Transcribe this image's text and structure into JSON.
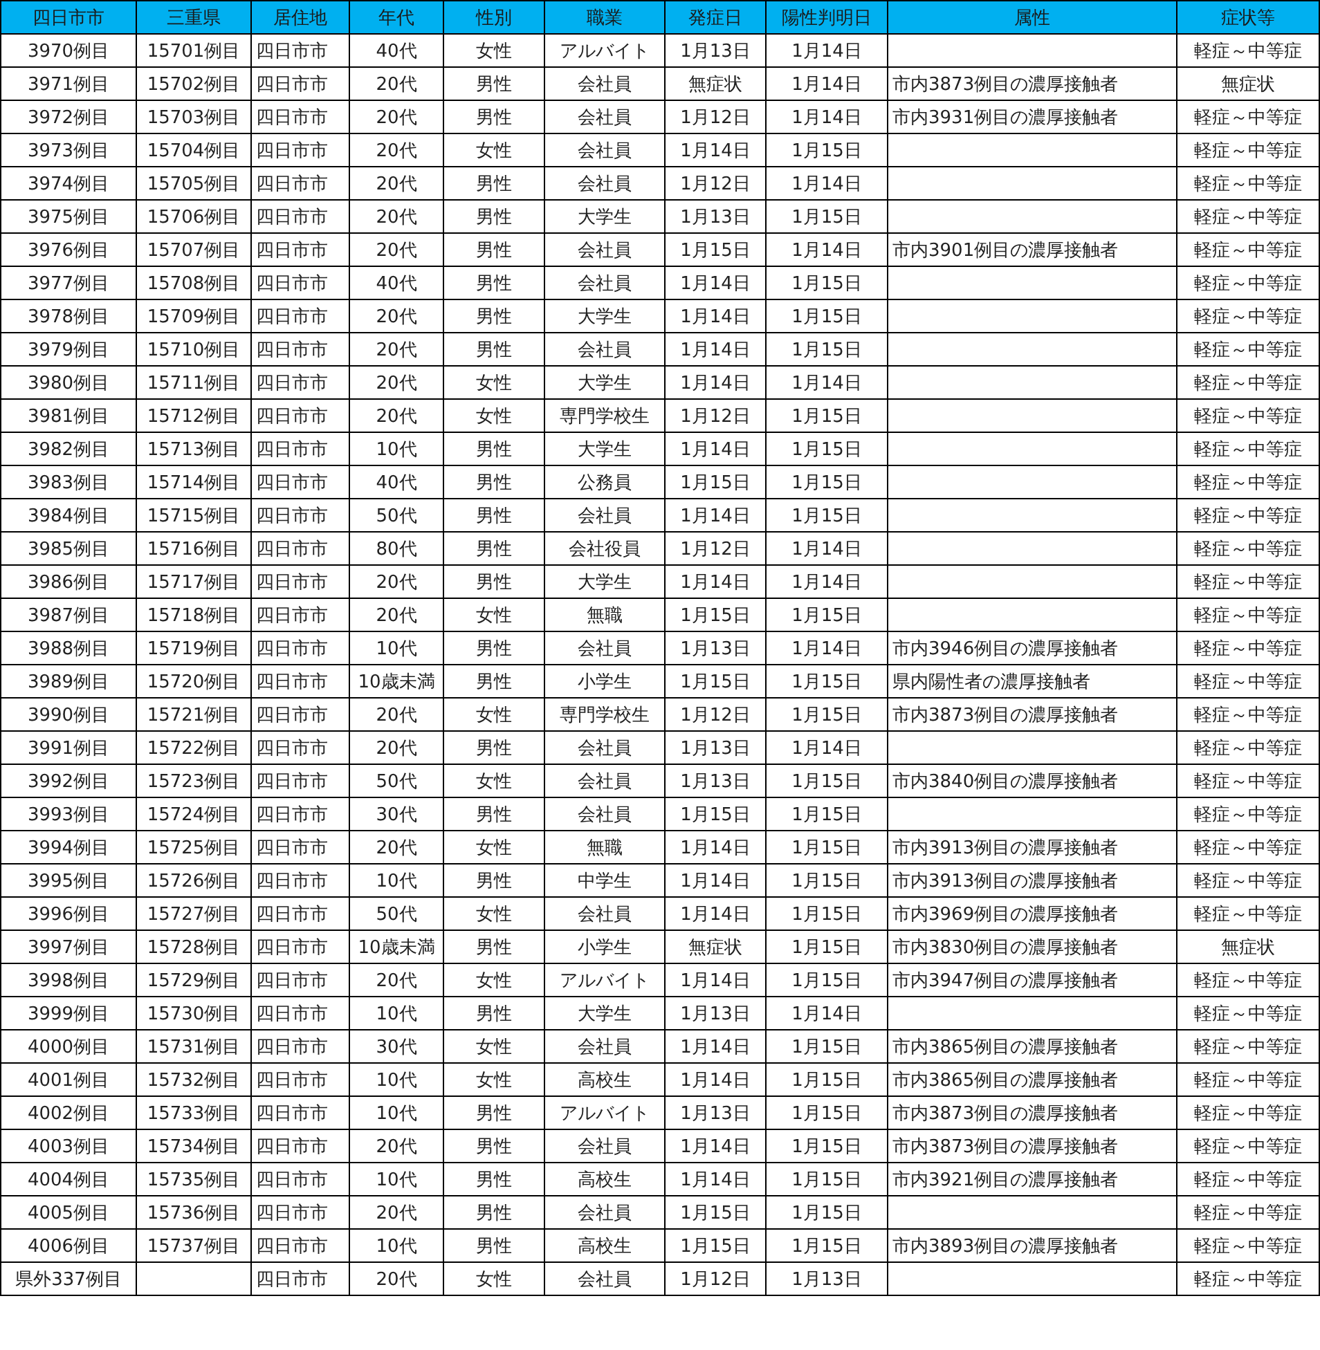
{
  "table": {
    "columns": [
      "四日市市",
      "三重県",
      "居住地",
      "年代",
      "性別",
      "職業",
      "発症日",
      "陽性判明日",
      "属性",
      "症状等"
    ],
    "rows": [
      {
        "city_no": "3970例目",
        "pref_no": "15701例目",
        "residence": "四日市市",
        "age": "40代",
        "sex": "女性",
        "occupation": "アルバイト",
        "onset": "1月13日",
        "confirmed": "1月14日",
        "symptoms": "軽症～中等症"
      },
      {
        "city_no": "3971例目",
        "pref_no": "15702例目",
        "residence": "四日市市",
        "age": "20代",
        "sex": "男性",
        "occupation": "会社員",
        "onset": "無症状",
        "confirmed": "1月14日",
        "attribute": "市内3873例目の濃厚接触者",
        "symptoms": "無症状"
      },
      {
        "city_no": "3972例目",
        "pref_no": "15703例目",
        "residence": "四日市市",
        "age": "20代",
        "sex": "男性",
        "occupation": "会社員",
        "onset": "1月12日",
        "confirmed": "1月14日",
        "attribute": "市内3931例目の濃厚接触者",
        "symptoms": "軽症～中等症"
      },
      {
        "city_no": "3973例目",
        "pref_no": "15704例目",
        "residence": "四日市市",
        "age": "20代",
        "sex": "女性",
        "occupation": "会社員",
        "onset": "1月14日",
        "confirmed": "1月15日",
        "symptoms": "軽症～中等症"
      },
      {
        "city_no": "3974例目",
        "pref_no": "15705例目",
        "residence": "四日市市",
        "age": "20代",
        "sex": "男性",
        "occupation": "会社員",
        "onset": "1月12日",
        "confirmed": "1月14日",
        "symptoms": "軽症～中等症"
      },
      {
        "city_no": "3975例目",
        "pref_no": "15706例目",
        "residence": "四日市市",
        "age": "20代",
        "sex": "男性",
        "occupation": "大学生",
        "onset": "1月13日",
        "confirmed": "1月15日",
        "symptoms": "軽症～中等症"
      },
      {
        "city_no": "3976例目",
        "pref_no": "15707例目",
        "residence": "四日市市",
        "age": "20代",
        "sex": "男性",
        "occupation": "会社員",
        "onset": "1月15日",
        "confirmed": "1月14日",
        "attribute": "市内3901例目の濃厚接触者",
        "symptoms": "軽症～中等症"
      },
      {
        "city_no": "3977例目",
        "pref_no": "15708例目",
        "residence": "四日市市",
        "age": "40代",
        "sex": "男性",
        "occupation": "会社員",
        "onset": "1月14日",
        "confirmed": "1月15日",
        "symptoms": "軽症～中等症"
      },
      {
        "city_no": "3978例目",
        "pref_no": "15709例目",
        "residence": "四日市市",
        "age": "20代",
        "sex": "男性",
        "occupation": "大学生",
        "onset": "1月14日",
        "confirmed": "1月15日",
        "symptoms": "軽症～中等症"
      },
      {
        "city_no": "3979例目",
        "pref_no": "15710例目",
        "residence": "四日市市",
        "age": "20代",
        "sex": "男性",
        "occupation": "会社員",
        "onset": "1月14日",
        "confirmed": "1月15日",
        "symptoms": "軽症～中等症"
      },
      {
        "city_no": "3980例目",
        "pref_no": "15711例目",
        "residence": "四日市市",
        "age": "20代",
        "sex": "女性",
        "occupation": "大学生",
        "onset": "1月14日",
        "confirmed": "1月14日",
        "symptoms": "軽症～中等症"
      },
      {
        "city_no": "3981例目",
        "pref_no": "15712例目",
        "residence": "四日市市",
        "age": "20代",
        "sex": "女性",
        "occupation": "専門学校生",
        "onset": "1月12日",
        "confirmed": "1月15日",
        "symptoms": "軽症～中等症"
      },
      {
        "city_no": "3982例目",
        "pref_no": "15713例目",
        "residence": "四日市市",
        "age": "10代",
        "sex": "男性",
        "occupation": "大学生",
        "onset": "1月14日",
        "confirmed": "1月15日",
        "symptoms": "軽症～中等症"
      },
      {
        "city_no": "3983例目",
        "pref_no": "15714例目",
        "residence": "四日市市",
        "age": "40代",
        "sex": "男性",
        "occupation": "公務員",
        "onset": "1月15日",
        "confirmed": "1月15日",
        "symptoms": "軽症～中等症"
      },
      {
        "city_no": "3984例目",
        "pref_no": "15715例目",
        "residence": "四日市市",
        "age": "50代",
        "sex": "男性",
        "occupation": "会社員",
        "onset": "1月14日",
        "confirmed": "1月15日",
        "symptoms": "軽症～中等症"
      },
      {
        "city_no": "3985例目",
        "pref_no": "15716例目",
        "residence": "四日市市",
        "age": "80代",
        "sex": "男性",
        "occupation": "会社役員",
        "onset": "1月12日",
        "confirmed": "1月14日",
        "symptoms": "軽症～中等症"
      },
      {
        "city_no": "3986例目",
        "pref_no": "15717例目",
        "residence": "四日市市",
        "age": "20代",
        "sex": "男性",
        "occupation": "大学生",
        "onset": "1月14日",
        "confirmed": "1月14日",
        "symptoms": "軽症～中等症"
      },
      {
        "city_no": "3987例目",
        "pref_no": "15718例目",
        "residence": "四日市市",
        "age": "20代",
        "sex": "女性",
        "occupation": "無職",
        "onset": "1月15日",
        "confirmed": "1月15日",
        "symptoms": "軽症～中等症"
      },
      {
        "city_no": "3988例目",
        "pref_no": "15719例目",
        "residence": "四日市市",
        "age": "10代",
        "sex": "男性",
        "occupation": "会社員",
        "onset": "1月13日",
        "confirmed": "1月14日",
        "attribute": "市内3946例目の濃厚接触者",
        "symptoms": "軽症～中等症"
      },
      {
        "city_no": "3989例目",
        "pref_no": "15720例目",
        "residence": "四日市市",
        "age": "10歳未満",
        "sex": "男性",
        "occupation": "小学生",
        "onset": "1月15日",
        "confirmed": "1月15日",
        "attribute": "県内陽性者の濃厚接触者",
        "symptoms": "軽症～中等症"
      },
      {
        "city_no": "3990例目",
        "pref_no": "15721例目",
        "residence": "四日市市",
        "age": "20代",
        "sex": "女性",
        "occupation": "専門学校生",
        "onset": "1月12日",
        "confirmed": "1月15日",
        "attribute": "市内3873例目の濃厚接触者",
        "symptoms": "軽症～中等症"
      },
      {
        "city_no": "3991例目",
        "pref_no": "15722例目",
        "residence": "四日市市",
        "age": "20代",
        "sex": "男性",
        "occupation": "会社員",
        "onset": "1月13日",
        "confirmed": "1月14日",
        "symptoms": "軽症～中等症"
      },
      {
        "city_no": "3992例目",
        "pref_no": "15723例目",
        "residence": "四日市市",
        "age": "50代",
        "sex": "女性",
        "occupation": "会社員",
        "onset": "1月13日",
        "confirmed": "1月15日",
        "attribute": "市内3840例目の濃厚接触者",
        "symptoms": "軽症～中等症"
      },
      {
        "city_no": "3993例目",
        "pref_no": "15724例目",
        "residence": "四日市市",
        "age": "30代",
        "sex": "男性",
        "occupation": "会社員",
        "onset": "1月15日",
        "confirmed": "1月15日",
        "symptoms": "軽症～中等症"
      },
      {
        "city_no": "3994例目",
        "pref_no": "15725例目",
        "residence": "四日市市",
        "age": "20代",
        "sex": "女性",
        "occupation": "無職",
        "onset": "1月14日",
        "confirmed": "1月15日",
        "attribute": "市内3913例目の濃厚接触者",
        "symptoms": "軽症～中等症"
      },
      {
        "city_no": "3995例目",
        "pref_no": "15726例目",
        "residence": "四日市市",
        "age": "10代",
        "sex": "男性",
        "occupation": "中学生",
        "onset": "1月14日",
        "confirmed": "1月15日",
        "attribute": "市内3913例目の濃厚接触者",
        "symptoms": "軽症～中等症"
      },
      {
        "city_no": "3996例目",
        "pref_no": "15727例目",
        "residence": "四日市市",
        "age": "50代",
        "sex": "女性",
        "occupation": "会社員",
        "onset": "1月14日",
        "confirmed": "1月15日",
        "attribute": "市内3969例目の濃厚接触者",
        "symptoms": "軽症～中等症"
      },
      {
        "city_no": "3997例目",
        "pref_no": "15728例目",
        "residence": "四日市市",
        "age": "10歳未満",
        "sex": "男性",
        "occupation": "小学生",
        "onset": "無症状",
        "confirmed": "1月15日",
        "attribute": "市内3830例目の濃厚接触者",
        "symptoms": "無症状"
      },
      {
        "city_no": "3998例目",
        "pref_no": "15729例目",
        "residence": "四日市市",
        "age": "20代",
        "sex": "女性",
        "occupation": "アルバイト",
        "onset": "1月14日",
        "confirmed": "1月15日",
        "attribute": "市内3947例目の濃厚接触者",
        "symptoms": "軽症～中等症"
      },
      {
        "city_no": "3999例目",
        "pref_no": "15730例目",
        "residence": "四日市市",
        "age": "10代",
        "sex": "男性",
        "occupation": "大学生",
        "onset": "1月13日",
        "confirmed": "1月14日",
        "symptoms": "軽症～中等症"
      },
      {
        "city_no": "4000例目",
        "pref_no": "15731例目",
        "residence": "四日市市",
        "age": "30代",
        "sex": "女性",
        "occupation": "会社員",
        "onset": "1月14日",
        "confirmed": "1月15日",
        "attribute": "市内3865例目の濃厚接触者",
        "symptoms": "軽症～中等症"
      },
      {
        "city_no": "4001例目",
        "pref_no": "15732例目",
        "residence": "四日市市",
        "age": "10代",
        "sex": "女性",
        "occupation": "高校生",
        "onset": "1月14日",
        "confirmed": "1月15日",
        "attribute": "市内3865例目の濃厚接触者",
        "symptoms": "軽症～中等症"
      },
      {
        "city_no": "4002例目",
        "pref_no": "15733例目",
        "residence": "四日市市",
        "age": "10代",
        "sex": "男性",
        "occupation": "アルバイト",
        "onset": "1月13日",
        "confirmed": "1月15日",
        "attribute": "市内3873例目の濃厚接触者",
        "symptoms": "軽症～中等症"
      },
      {
        "city_no": "4003例目",
        "pref_no": "15734例目",
        "residence": "四日市市",
        "age": "20代",
        "sex": "男性",
        "occupation": "会社員",
        "onset": "1月14日",
        "confirmed": "1月15日",
        "attribute": "市内3873例目の濃厚接触者",
        "symptoms": "軽症～中等症"
      },
      {
        "city_no": "4004例目",
        "pref_no": "15735例目",
        "residence": "四日市市",
        "age": "10代",
        "sex": "男性",
        "occupation": "高校生",
        "onset": "1月14日",
        "confirmed": "1月15日",
        "attribute": "市内3921例目の濃厚接触者",
        "symptoms": "軽症～中等症"
      },
      {
        "city_no": "4005例目",
        "pref_no": "15736例目",
        "residence": "四日市市",
        "age": "20代",
        "sex": "男性",
        "occupation": "会社員",
        "onset": "1月15日",
        "confirmed": "1月15日",
        "symptoms": "軽症～中等症"
      },
      {
        "city_no": "4006例目",
        "pref_no": "15737例目",
        "residence": "四日市市",
        "age": "10代",
        "sex": "男性",
        "occupation": "高校生",
        "onset": "1月15日",
        "confirmed": "1月15日",
        "attribute": "市内3893例目の濃厚接触者",
        "symptoms": "軽症～中等症"
      },
      {
        "city_no": "県外337例目",
        "residence": "四日市市",
        "age": "20代",
        "sex": "女性",
        "occupation": "会社員",
        "onset": "1月12日",
        "confirmed": "1月13日",
        "symptoms": "軽症～中等症"
      }
    ]
  }
}
